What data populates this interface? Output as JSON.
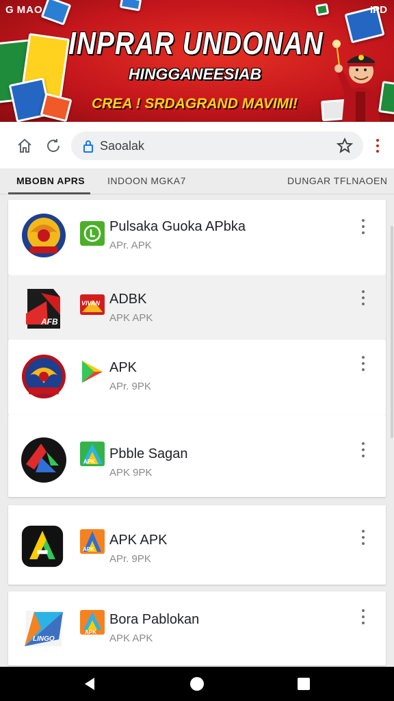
{
  "banner": {
    "corner_left": "G MAO",
    "corner_right": "IPD",
    "title": "INPRAR UNDONAN",
    "subtitle": "HINGGANEESIAB",
    "tagline": "CREA ! SRDAGRAND MAVIMI!",
    "colors": {
      "red": "#c4161c",
      "yellow": "#ffd21f"
    }
  },
  "browser": {
    "home_icon": "home-icon",
    "reload_icon": "reload-icon",
    "url_text": "Saoalak",
    "lock_icon": "lock-icon",
    "bookmark_icon": "star-icon",
    "menu_icon": "kebab-menu-icon"
  },
  "tabs": [
    {
      "label": "MBOBN APRS",
      "active": true
    },
    {
      "label": "INDOON MGKA7",
      "active": false
    },
    {
      "label": "DUNGAR TFLNAOEN",
      "active": false
    }
  ],
  "apps": [
    {
      "name": "Pulsaka Guoka APbka",
      "sub": "APr. APK",
      "logo": "garuda-emblem-logo",
      "icon": "green-circle-icon"
    },
    {
      "name": "ADBK",
      "sub": "APK APK",
      "logo": "afb-box-logo",
      "icon": "red-brand-icon",
      "logo_text": "AFB",
      "icon_text": "VIVAN"
    },
    {
      "name": "APK",
      "sub": "APr. 9PK",
      "logo": "garuda-badge-logo",
      "icon": "play-triangle-icon"
    },
    {
      "name": "Pbble Sagan",
      "sub": "APK 9PK",
      "logo": "black-circle-logo",
      "icon": "apk-green-icon",
      "icon_text": "APK"
    },
    {
      "name": "APK APK",
      "sub": "APr. 9PK",
      "logo": "letter-a-logo",
      "icon": "orange-triangle-icon",
      "icon_text": "APK"
    },
    {
      "name": "Bora Pablokan",
      "sub": "APK APK",
      "logo": "blue-triangle-logo",
      "icon": "orange-apk-icon",
      "logo_text": "LINGO",
      "icon_text": "APK"
    }
  ],
  "navbar": {
    "back": "back-icon",
    "home": "home-circle-icon",
    "recents": "recents-square-icon"
  }
}
